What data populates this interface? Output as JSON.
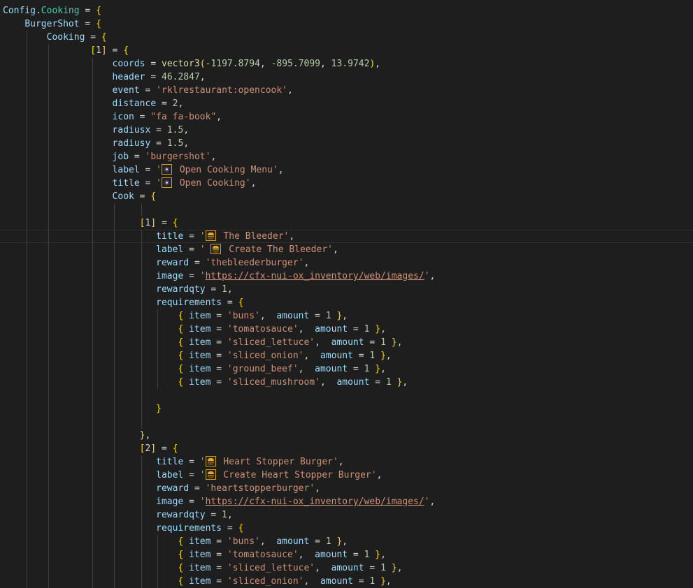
{
  "editor": {
    "colors": {
      "background": "#1e1e1e",
      "string": "#ce9178",
      "number": "#b5cea8",
      "variable": "#9cdcfe"
    },
    "lines": [
      "Config.Cooking = {",
      "    BurgerShot = {",
      "        Cooking = {",
      "                [1] = {",
      "                    coords = vector3(-1197.8794, -895.7099, 13.9742),",
      "                    header = 46.2847,",
      "                    event = 'rklrestaurant:opencook',",
      "                    distance = 2,",
      "                    icon = \"fa fa-book\",",
      "                    radiusx = 1.5,",
      "                    radiusy = 1.5,",
      "                    job = 'burgershot',",
      "                    label = '[eye] Open Cooking Menu',",
      "                    title = '[eye] Open Cooking',",
      "                    Cook = {",
      "",
      "                         [1] = {",
      "                            title = '[burger] The Bleeder',",
      "                            label = ' [burger] Create The Bleeder',",
      "                            reward = 'thebleederburger',",
      "                            image = 'https://cfx-nui-ox_inventory/web/images/',",
      "                            rewardqty = 1,",
      "                            requirements = {",
      "                                { item = 'buns',  amount = 1 },",
      "                                { item = 'tomatosauce',  amount = 1 },",
      "                                { item = 'sliced_lettuce',  amount = 1 },",
      "                                { item = 'sliced_onion',  amount = 1 },",
      "                                { item = 'ground_beef',  amount = 1 },",
      "                                { item = 'sliced_mushroom',  amount = 1 },",
      "",
      "                            }",
      "",
      "                         },",
      "                         [2] = {",
      "                            title = '[burger] Heart Stopper Burger',",
      "                            label = '[burger] Create Heart Stopper Burger',",
      "                            reward = 'heartstopperburger',",
      "                            image = 'https://cfx-nui-ox_inventory/web/images/',",
      "                            rewardqty = 1,",
      "                            requirements = {",
      "                                { item = 'buns',  amount = 1 },",
      "                                { item = 'tomatosauce',  amount = 1 },",
      "                                { item = 'sliced_lettuce',  amount = 1 },",
      "                                { item = 'sliced_onion',  amount = 1 },"
    ]
  }
}
